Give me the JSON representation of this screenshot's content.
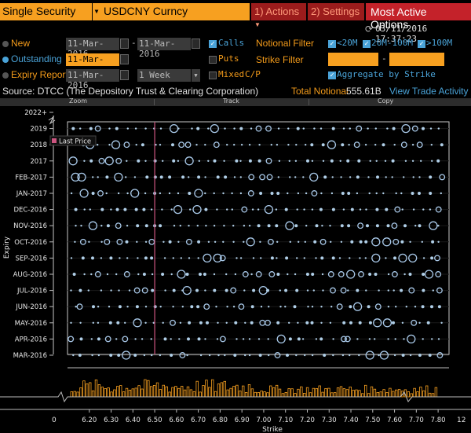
{
  "toolbar": {
    "security_type": "Single Security",
    "ticker": "USDCNY Curncy",
    "actions_label": "1) Actions",
    "settings_label": "2) Settings",
    "most_active_label": "Most Active Options"
  },
  "datetime": "03/11/2016 17:37:23",
  "filters": {
    "new_label": "New",
    "outstanding_label": "Outstanding",
    "expiry_report_label": "Expiry Report",
    "new_from": "11-Mar-2016",
    "new_sep": "-",
    "new_to": "11-Mar-2016",
    "outstanding_date": "11-Mar-2016",
    "expiry_date": "11-Mar-2016",
    "expiry_period": "1 Week",
    "calls_label": "Calls",
    "puts_label": "Puts",
    "mixed_label": "Mixed",
    "cp_label": "C/P",
    "notional_filter_label": "Notional Filter",
    "strike_filter_label": "Strike Filter",
    "strike_sep": "-",
    "lt20_label": "<20M",
    "mid_label": "20M-100M",
    "gt100_label": ">100M",
    "aggregate_label": "Aggregate by Strike"
  },
  "source_text": "Source: DTCC (The Depository Trust & Clearing Corporation)",
  "total_notional_label": "Total Notional",
  "total_notional_value": "555.61B",
  "view_trade_activity": "View Trade Activity",
  "chart_toolbar": {
    "zoom": "Zoom",
    "track": "Track",
    "copy": "Copy"
  },
  "legend": {
    "last_price": "Last Price"
  },
  "colors": {
    "accent_orange": "#f7a020",
    "dark_red": "#9b1c1c",
    "link_blue": "#4aa3d8",
    "marker_pink": "#cc5580"
  },
  "chart_data": {
    "type": "scatter",
    "xlabel": "Strike",
    "ylabel": "Expiry",
    "x_ticks": [
      "6.20",
      "6.30",
      "6.40",
      "6.50",
      "6.60",
      "6.70",
      "6.80",
      "6.90",
      "7.00",
      "7.10",
      "7.20",
      "7.30",
      "7.40",
      "7.50",
      "7.60",
      "7.70",
      "7.80"
    ],
    "x_axis_min_label": "0",
    "x_axis_max_label": "12",
    "y_ticks": [
      "2022+",
      "2019",
      "2018",
      "2017",
      "FEB-2017",
      "JAN-2017",
      "DEC-2016",
      "NOV-2016",
      "OCT-2016",
      "SEP-2016",
      "AUG-2016",
      "JUL-2016",
      "JUN-2016",
      "MAY-2016",
      "APR-2016",
      "MAR-2016"
    ],
    "last_price": 6.5,
    "xlim": [
      6.1,
      7.85
    ]
  }
}
